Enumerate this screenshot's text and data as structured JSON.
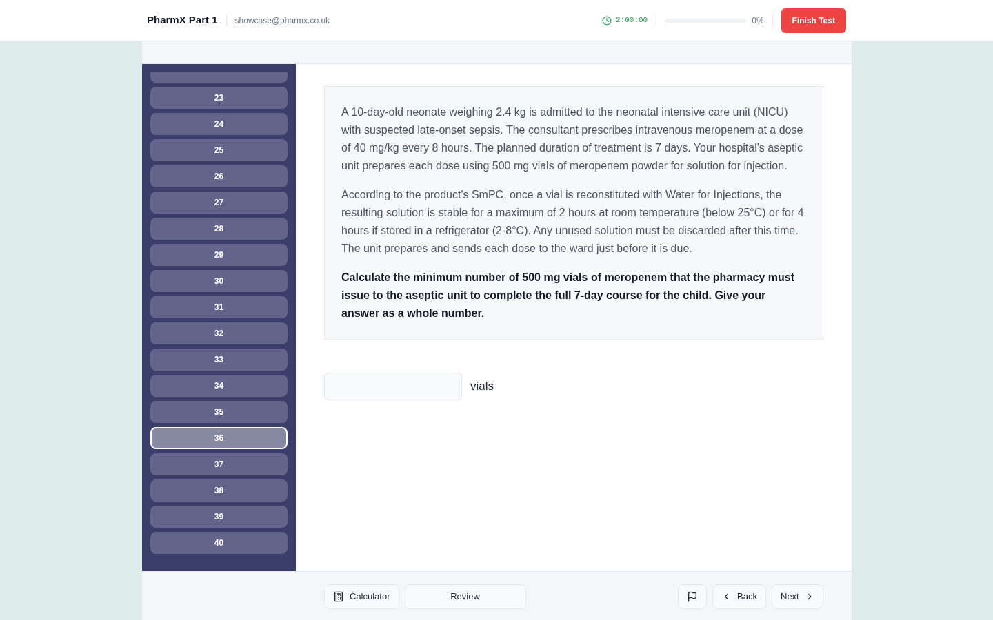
{
  "header": {
    "title": "PharmX Part 1",
    "email": "showcase@pharmx.co.uk",
    "timer": "2:00:00",
    "progress": {
      "level": 0,
      "reading": "0%"
    },
    "finish_button": "Finish Test"
  },
  "question_nav": [
    {
      "label": "23",
      "selected": false
    },
    {
      "label": "24",
      "selected": false
    },
    {
      "label": "25",
      "selected": false
    },
    {
      "label": "26",
      "selected": false
    },
    {
      "label": "27",
      "selected": false
    },
    {
      "label": "28",
      "selected": false
    },
    {
      "label": "29",
      "selected": false
    },
    {
      "label": "30",
      "selected": false
    },
    {
      "label": "31",
      "selected": false
    },
    {
      "label": "32",
      "selected": false
    },
    {
      "label": "33",
      "selected": false
    },
    {
      "label": "34",
      "selected": false
    },
    {
      "label": "35",
      "selected": false
    },
    {
      "label": "36",
      "selected": true
    },
    {
      "label": "37",
      "selected": false
    },
    {
      "label": "38",
      "selected": false
    },
    {
      "label": "39",
      "selected": false
    },
    {
      "label": "40",
      "selected": false
    }
  ],
  "question": {
    "paragraphs": [
      "A 10-day-old neonate weighing 2.4 kg is admitted to the neonatal intensive care unit (NICU) with suspected late-onset sepsis. The consultant prescribes intravenous meropenem at a dose of 40 mg/kg every 8 hours. The planned duration of treatment is 7 days. Your hospital's aseptic unit prepares each dose using 500 mg vials of meropenem powder for solution for injection.",
      "According to the product's SmPC, once a vial is reconstituted with Water for Injections, the resulting solution is stable for a maximum of 2 hours at room temperature (below 25°C) or for 4 hours if stored in a refrigerator (2-8°C). Any unused solution must be discarded after this time. The unit prepares and sends each dose to the ward just before it is due."
    ],
    "instruction": "Calculate the minimum number of 500 mg vials of meropenem that the pharmacy must issue to the aseptic unit to complete the full 7-day course for the child. Give your answer as a whole number."
  },
  "answer": {
    "unit": "vials"
  },
  "footer": {
    "tools": [
      {
        "kind": "calculator",
        "label": "Calculator"
      },
      {
        "kind": "review",
        "label": "Review"
      }
    ],
    "navigation": [
      {
        "kind": "flag"
      },
      {
        "kind": "back",
        "label": "Back"
      },
      {
        "kind": "next",
        "label": "Next"
      }
    ]
  }
}
